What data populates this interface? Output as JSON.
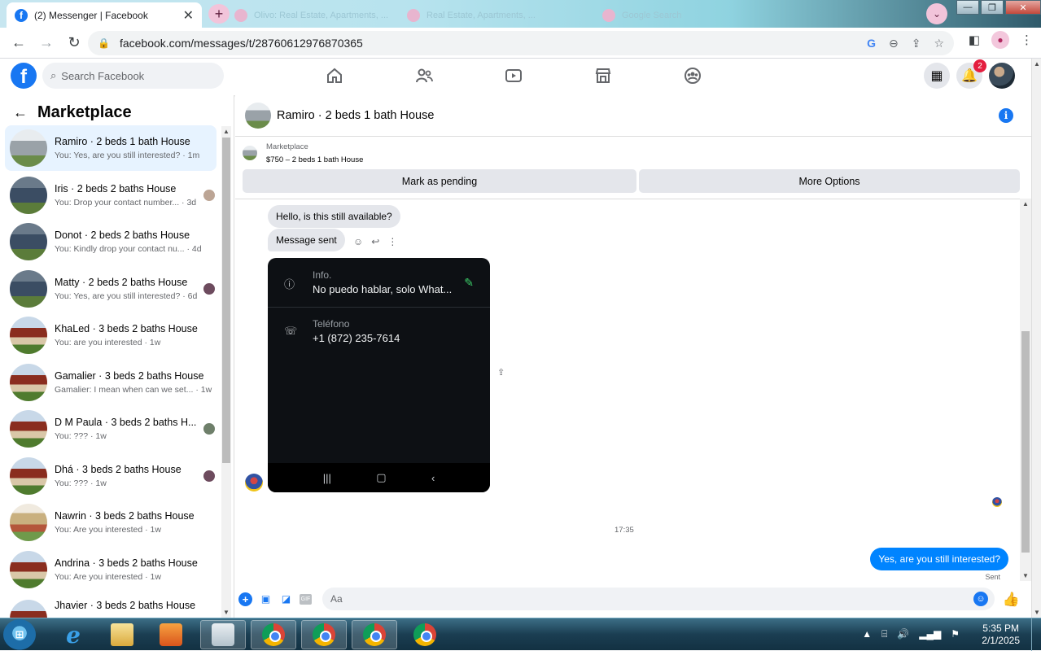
{
  "browser": {
    "active_tab_title": "(2) Messenger | Facebook",
    "bg_tab_1": "Olivo: Real Estate, Apartments, ...",
    "bg_tab_2": "Real Estate, Apartments, ...",
    "bg_tab_3": "Google Search",
    "url": "facebook.com/messages/t/28760612976870365"
  },
  "fb": {
    "search_placeholder": "Search Facebook",
    "notifications_count": "2"
  },
  "sidebar": {
    "title": "Marketplace",
    "conversations": [
      {
        "name": "Ramiro · 2 beds 1 bath House",
        "preview": "You: Yes, are you still interested? · 1m"
      },
      {
        "name": "Iris · 2 beds 2 baths House",
        "preview": "You: Drop your contact number... · 3d"
      },
      {
        "name": "Donot · 2 beds 2 baths House",
        "preview": "You: Kindly drop your contact nu... · 4d"
      },
      {
        "name": "Matty · 2 beds 2 baths House",
        "preview": "You: Yes, are you still interested? · 6d"
      },
      {
        "name": "KhaLed · 3 beds 2 baths House",
        "preview": "You: are you interested · 1w"
      },
      {
        "name": "Gamalier · 3 beds 2 baths House",
        "preview": "Gamalier: I mean when can we set... · 1w"
      },
      {
        "name": "D M Paula · 3 beds 2 baths H...",
        "preview": "You: ??? · 1w"
      },
      {
        "name": "Dhá · 3 beds 2 baths House",
        "preview": "You: ??? · 1w"
      },
      {
        "name": "Nawrin · 3 beds 2 baths House",
        "preview": "You: Are you interested · 1w"
      },
      {
        "name": "Andrina · 3 beds 2 baths House",
        "preview": "You: Are you interested · 1w"
      },
      {
        "name": "Jhavier · 3 beds 2 baths House",
        "preview": ""
      }
    ]
  },
  "chat": {
    "header_title": "Ramiro · 2 beds 1 bath House",
    "listing_label": "Marketplace",
    "listing_detail": "$750 – 2 beds 1 bath House",
    "mark_pending": "Mark as pending",
    "more_options": "More Options",
    "msg_in_1": "Hello, is this still available?",
    "msg_in_2": "Message sent",
    "phone_info_label": "Info.",
    "phone_info_value": "No puedo hablar, solo What...",
    "phone_tel_label": "Teléfono",
    "phone_tel_value": "+1 (872) 235-7614",
    "timestamp": "17:35",
    "msg_out": "Yes, are you still interested?",
    "sent_status": "Sent",
    "composer_placeholder": "Aa"
  },
  "taskbar": {
    "time": "5:35 PM",
    "date": "2/1/2025"
  }
}
